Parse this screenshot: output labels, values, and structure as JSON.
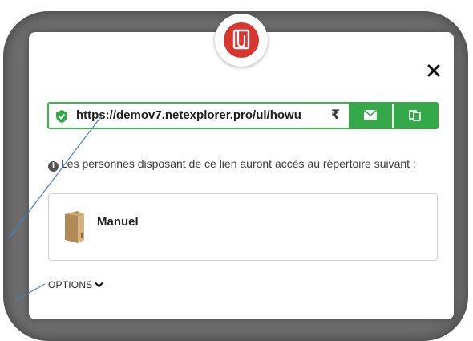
{
  "share_dialog": {
    "close_symbol": "✕",
    "link": {
      "url": "https://demov7.netexplorer.pro/ul/howu",
      "refresh_symbol": "₹"
    },
    "info_message": "Les personnes disposant de ce lien auront accès au répertoire suivant :",
    "folder": {
      "name": "Manuel"
    },
    "options_label": "OPTIONS"
  },
  "colors": {
    "accent_green": "#35a849",
    "badge_red": "#d8372f",
    "callout_line": "#4a7fc0"
  },
  "icons": {
    "badge": "share-link-icon",
    "secure": "shield-check-icon",
    "mail": "envelope-icon",
    "copy": "copy-icon",
    "folder": "folder-icon",
    "info": "info-icon",
    "options": "chevron-down-icon"
  }
}
